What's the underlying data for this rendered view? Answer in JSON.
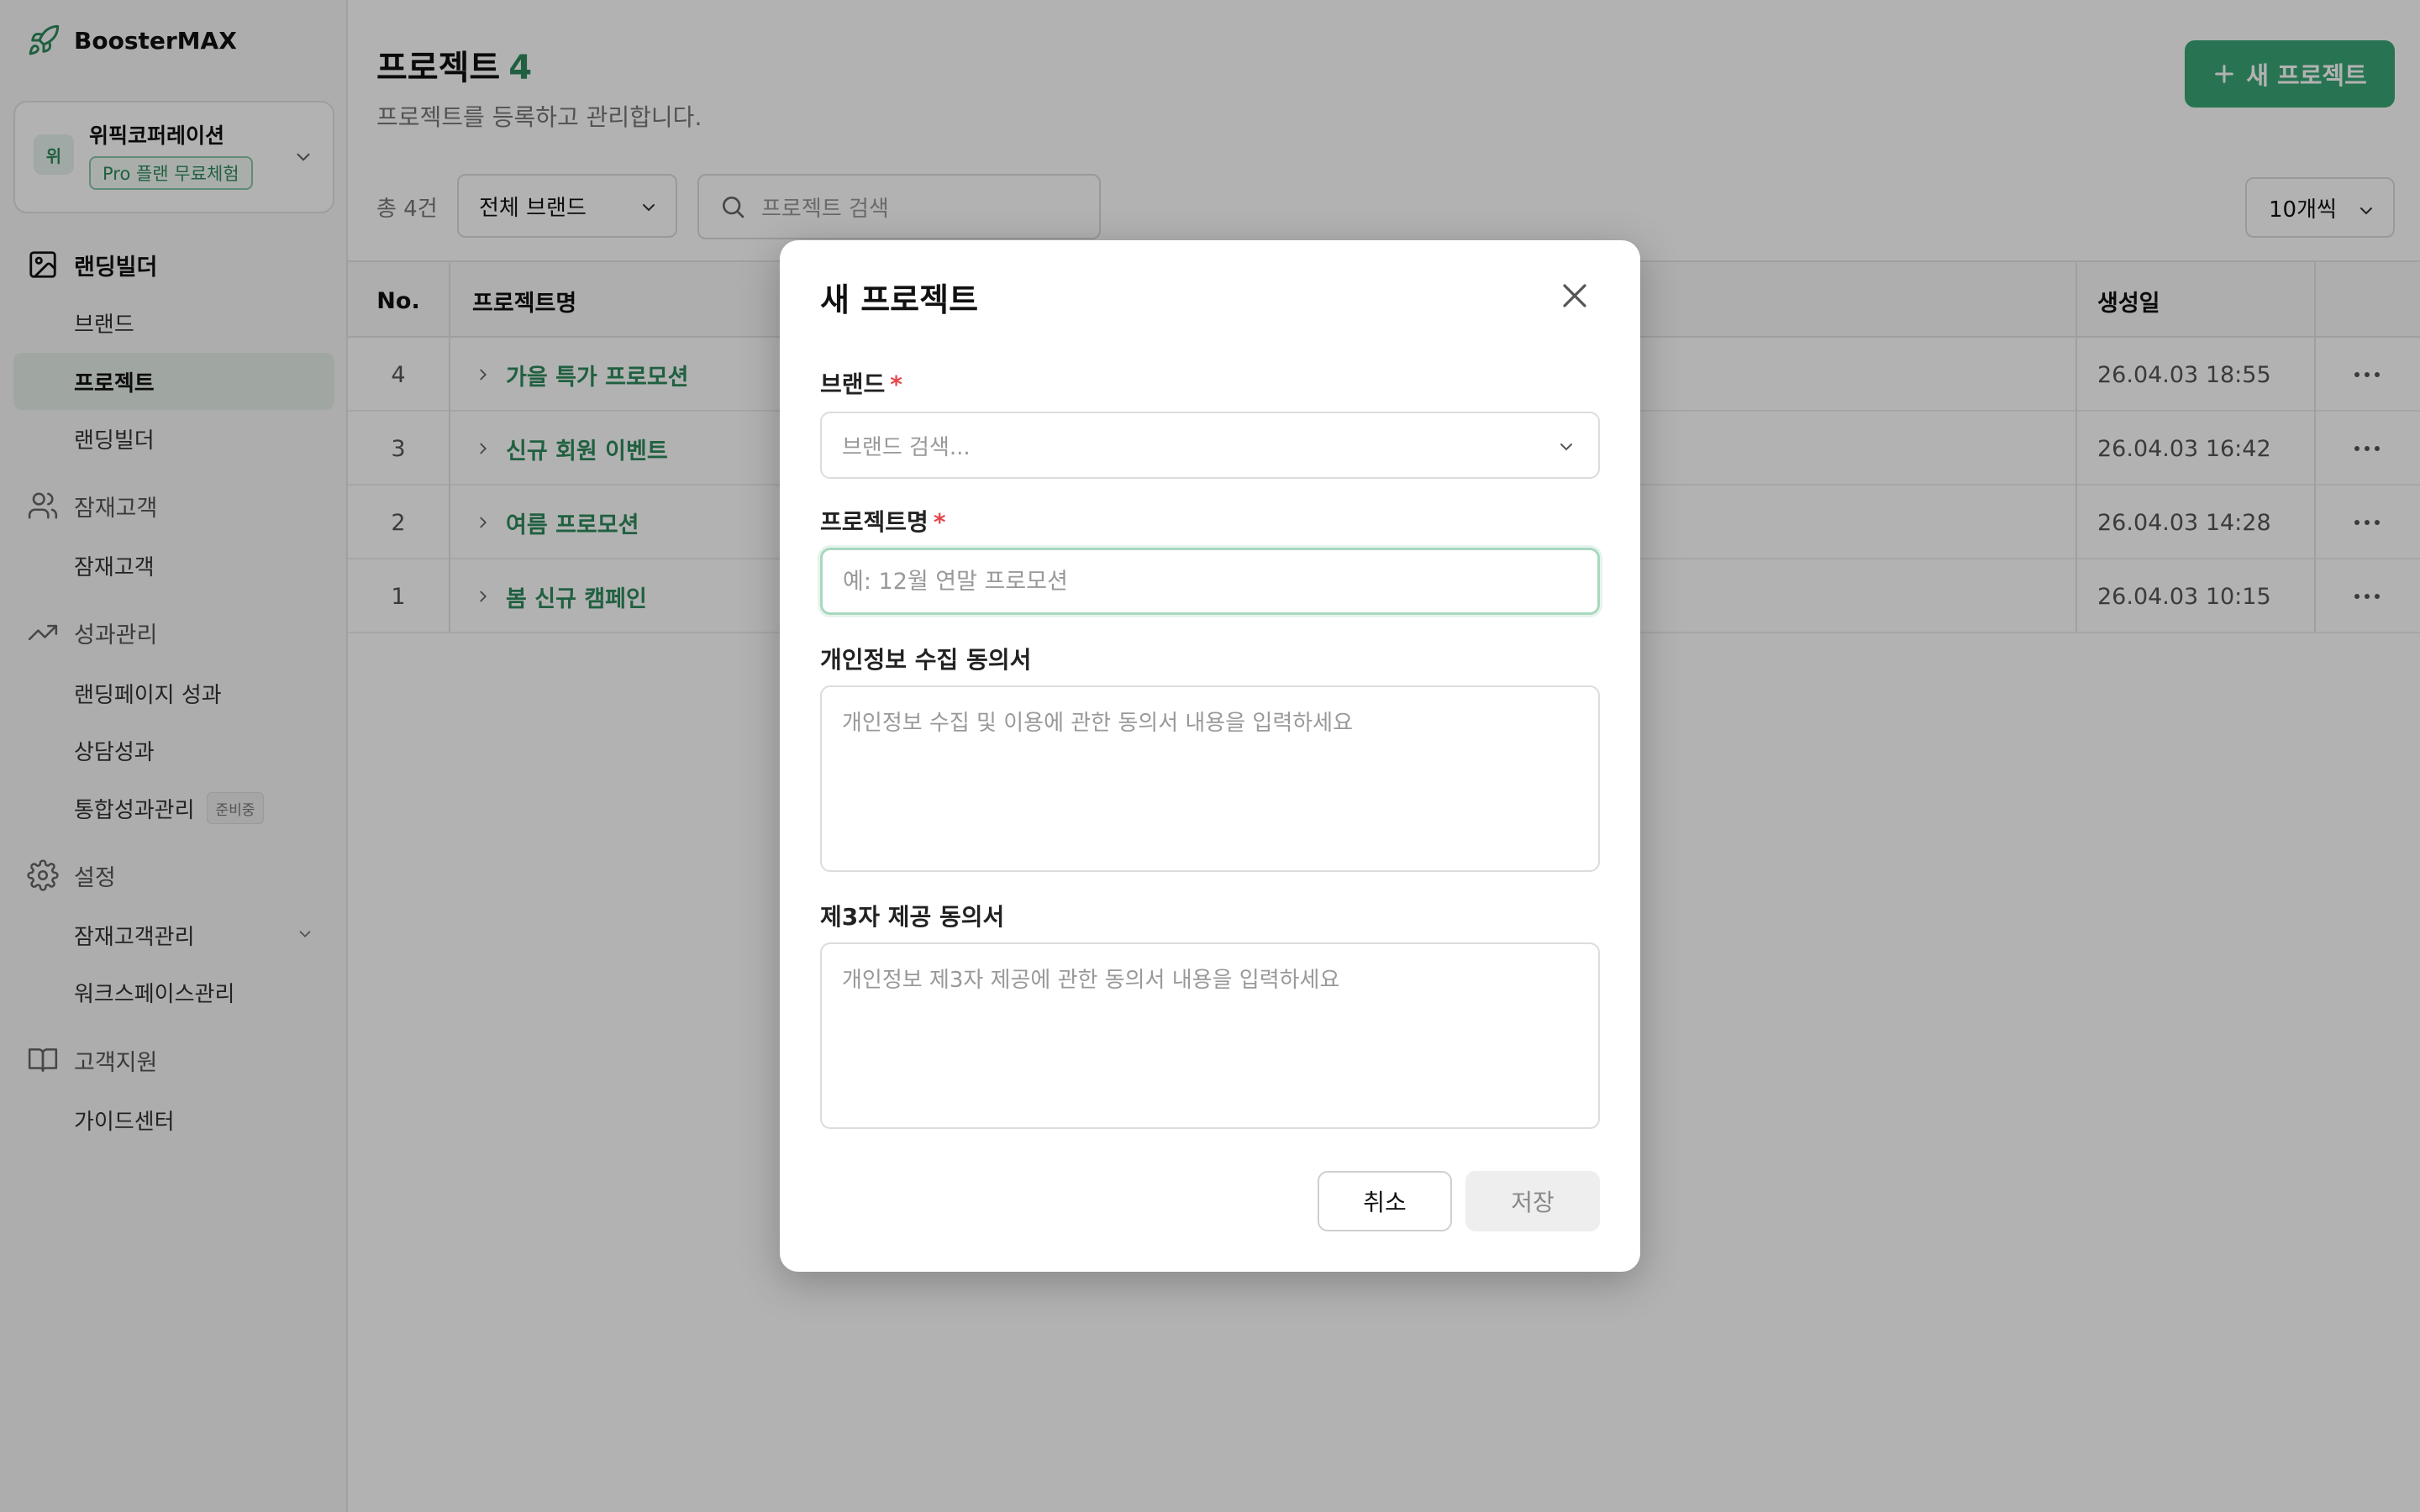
{
  "app": {
    "name": "BoosterMAX"
  },
  "workspace": {
    "avatar": "위",
    "name": "위픽코퍼레이션",
    "plan_badge": "Pro 플랜 무료체험"
  },
  "sidebar": {
    "sections": [
      {
        "label": "랜딩빌더",
        "icon": "image-icon",
        "items": [
          "브랜드",
          "프로젝트",
          "랜딩빌더"
        ]
      },
      {
        "label": "잠재고객",
        "icon": "users-icon",
        "items": [
          "잠재고객"
        ]
      },
      {
        "label": "성과관리",
        "icon": "trending-up-icon",
        "items": [
          "랜딩페이지 성과",
          "상담성과",
          "통합성과관리"
        ]
      },
      {
        "label": "설정",
        "icon": "gear-icon",
        "items": [
          "잠재고객관리",
          "워크스페이스관리"
        ]
      },
      {
        "label": "고객지원",
        "icon": "book-icon",
        "items": [
          "가이드센터"
        ]
      }
    ],
    "ready_tag": "준비중"
  },
  "page": {
    "title": "프로젝트",
    "count": "4",
    "subtitle": "프로젝트를 등록하고 관리합니다.",
    "new_button": "새 프로젝트"
  },
  "filters": {
    "total": "총 4건",
    "brand_select": "전체 브랜드",
    "search_placeholder": "프로젝트 검색",
    "per_page": "10개씩"
  },
  "table": {
    "headers": {
      "no": "No.",
      "name": "프로젝트명",
      "created": "생성일"
    },
    "rows": [
      {
        "no": "4",
        "name": "가을 특가 프로모션",
        "created": "26.04.03 18:55"
      },
      {
        "no": "3",
        "name": "신규 회원 이벤트",
        "created": "26.04.03 16:42"
      },
      {
        "no": "2",
        "name": "여름 프로모션",
        "created": "26.04.03 14:28"
      },
      {
        "no": "1",
        "name": "봄 신규 캠페인",
        "created": "26.04.03 10:15"
      }
    ]
  },
  "modal": {
    "title": "새 프로젝트",
    "brand_label": "브랜드",
    "brand_placeholder": "브랜드 검색...",
    "project_label": "프로젝트명",
    "project_placeholder": "예: 12월 연말 프로모션",
    "privacy_label": "개인정보 수집 동의서",
    "privacy_placeholder": "개인정보 수집 및 이용에 관한 동의서 내용을 입력하세요",
    "third_label": "제3자 제공 동의서",
    "third_placeholder": "개인정보 제3자 제공에 관한 동의서 내용을 입력하세요",
    "required_mark": "*",
    "cancel": "취소",
    "save": "저장"
  },
  "colors": {
    "accent": "#3aa776",
    "accent_text": "#2f8a5c",
    "required": "#e5484d"
  }
}
